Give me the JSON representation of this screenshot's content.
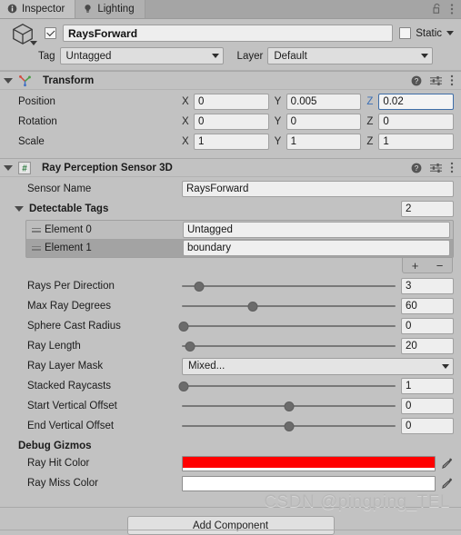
{
  "window": {
    "tabs": [
      {
        "label": "Inspector",
        "icon": "info-icon",
        "active": true
      },
      {
        "label": "Lighting",
        "icon": "lightbulb-icon",
        "active": false
      }
    ],
    "tools": [
      {
        "name": "lock-icon",
        "label": ""
      },
      {
        "name": "kebab-menu-icon",
        "label": ""
      }
    ]
  },
  "gameobject": {
    "icon": "cube-icon",
    "enabled": true,
    "name": "RaysForward",
    "static": {
      "label": "Static",
      "checked": false
    },
    "tag": {
      "label": "Tag",
      "value": "Untagged"
    },
    "layer": {
      "label": "Layer",
      "value": "Default"
    }
  },
  "components": [
    {
      "title": "Transform",
      "icon": "transform-axes-icon",
      "expanded": true,
      "tools": [
        "help-icon",
        "preset-icon",
        "kebab-menu-icon"
      ],
      "vectors": [
        {
          "label": "Position",
          "x": "0",
          "y": "0.005",
          "z": "0.02",
          "focused_axis": "z"
        },
        {
          "label": "Rotation",
          "x": "0",
          "y": "0",
          "z": "0",
          "focused_axis": ""
        },
        {
          "label": "Scale",
          "x": "1",
          "y": "1",
          "z": "1",
          "focused_axis": ""
        }
      ],
      "axis_labels": {
        "x": "X",
        "y": "Y",
        "z": "Z"
      }
    },
    {
      "title": "Ray Perception Sensor 3D",
      "icon": "cs-script-icon",
      "expanded": true,
      "tools": [
        "help-icon",
        "preset-icon",
        "kebab-menu-icon"
      ]
    }
  ],
  "sensor": {
    "sensor_name": {
      "label": "Sensor Name",
      "value": "RaysForward"
    },
    "detectable_tags": {
      "label": "Detectable Tags",
      "count": "2",
      "elements": [
        {
          "label": "Element 0",
          "value": "Untagged",
          "selected": false
        },
        {
          "label": "Element 1",
          "value": "boundary",
          "selected": true
        }
      ],
      "add_label": "+",
      "remove_label": "−"
    },
    "sliders": [
      {
        "label": "Rays Per Direction",
        "value": "3",
        "fill": 8
      },
      {
        "label": "Max Ray Degrees",
        "value": "60",
        "fill": 33
      },
      {
        "label": "Sphere Cast Radius",
        "value": "0",
        "fill": 1
      },
      {
        "label": "Ray Length",
        "value": "20",
        "fill": 4
      }
    ],
    "layer_mask": {
      "label": "Ray Layer Mask",
      "value": "Mixed..."
    },
    "sliders2": [
      {
        "label": "Stacked Raycasts",
        "value": "1",
        "fill": 1
      },
      {
        "label": "Start Vertical Offset",
        "value": "0",
        "fill": 50
      },
      {
        "label": "End Vertical Offset",
        "value": "0",
        "fill": 50
      }
    ],
    "debug_gizmos": {
      "title": "Debug Gizmos",
      "colors": [
        {
          "label": "Ray Hit Color",
          "value": "#FF0000",
          "alpha": "#FFFFFF"
        },
        {
          "label": "Ray Miss Color",
          "value": "#FFFFFF",
          "alpha": "#FFFFFF"
        }
      ],
      "picker_icon": "eyedropper-icon"
    }
  },
  "footer": {
    "add_component_label": "Add Component"
  },
  "watermark": {
    "text": "CSDN @pingping_TEL"
  }
}
